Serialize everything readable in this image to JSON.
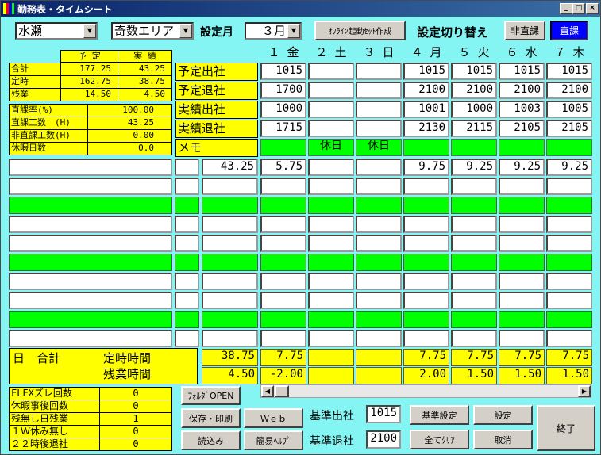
{
  "title": "勤務表・タイムシート",
  "window_buttons": [
    "_",
    "□",
    "×"
  ],
  "header": {
    "name": "水瀬",
    "area": "奇数エリア",
    "setting_month_label": "設定月",
    "month": "３月",
    "offline_button": "ｵﾌﾗｲﾝ起動ｾｯﾄ作成",
    "switch_label": "設定切り替え",
    "indirect_button": "非直課",
    "direct_button": "直課"
  },
  "summary": {
    "col_plan": "予 定",
    "col_actual": "実 績",
    "rows": [
      {
        "label": "合計",
        "plan": "177.25",
        "actual": "43.25"
      },
      {
        "label": "定時",
        "plan": "162.75",
        "actual": "38.75"
      },
      {
        "label": "残業",
        "plan": "14.50",
        "actual": "4.50"
      }
    ]
  },
  "stats": [
    {
      "label": "直課率(%)",
      "value": "100.00"
    },
    {
      "label": "直課工数　(H)",
      "value": "43.25"
    },
    {
      "label": "非直課工数(H)",
      "value": "0.00"
    },
    {
      "label": "休暇日数",
      "value": "0.0"
    }
  ],
  "row_labels": [
    "予定出社",
    "予定退社",
    "実績出社",
    "実績退社",
    "メモ"
  ],
  "days": [
    "１ 金",
    "２ 土",
    "３ 日",
    "４ 月",
    "５ 火",
    "６ 水",
    "７ 木"
  ],
  "grid": [
    [
      "1015",
      "",
      "",
      "1015",
      "1015",
      "1015",
      "1015"
    ],
    [
      "1700",
      "",
      "",
      "2100",
      "2100",
      "2100",
      "2100"
    ],
    [
      "1000",
      "",
      "",
      "1001",
      "1000",
      "1003",
      "1005"
    ],
    [
      "1715",
      "",
      "",
      "2130",
      "2115",
      "2105",
      "2105"
    ],
    [
      "",
      "休日",
      "休日",
      "",
      "",
      "",
      ""
    ]
  ],
  "work_total": "43.25",
  "work_row": [
    "5.75",
    "",
    "",
    "9.75",
    "9.25",
    "9.25",
    "9.25"
  ],
  "daily": {
    "label": "日　合計",
    "regular_label": "定時時間",
    "overtime_label": "残業時間",
    "regular_total": "38.75",
    "overtime_total": "4.50",
    "regular": [
      "7.75",
      "",
      "",
      "7.75",
      "7.75",
      "7.75",
      "7.75"
    ],
    "overtime": [
      "-2.00",
      "",
      "",
      "2.00",
      "1.50",
      "1.50",
      "1.50"
    ]
  },
  "counters": [
    {
      "label": "FLEXズレ回数",
      "value": "0"
    },
    {
      "label": "休暇事後回数",
      "value": "0"
    },
    {
      "label": "残無し日残業",
      "value": "1"
    },
    {
      "label": "１Ｗ休み無し",
      "value": "0"
    },
    {
      "label": "２２時後退社",
      "value": "0"
    }
  ],
  "buttons": {
    "folder_open": "ﾌｫﾙﾀﾞOPEN",
    "save_print": "保存・印刷",
    "web": "Ｗｅｂ",
    "load": "読込み",
    "help": "簡易ﾍﾙﾌﾟ",
    "std_set": "基準設定",
    "set": "設定",
    "clear_all": "全てｸﾘｱ",
    "cancel": "取消",
    "exit": "終了"
  },
  "standard": {
    "in_label": "基準出社",
    "in_value": "1015",
    "out_label": "基準退社",
    "out_value": "2100"
  },
  "colors": {
    "accent": "#ffff00",
    "green": "#00ff00",
    "bg": "#84f5f2",
    "direct": "#0000ff"
  }
}
